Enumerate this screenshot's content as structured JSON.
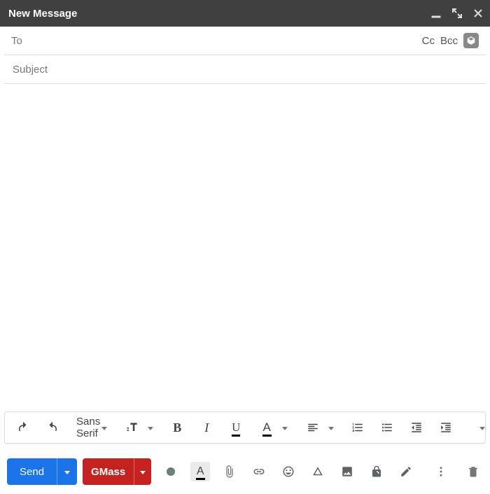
{
  "window": {
    "title": "New Message"
  },
  "to_field": {
    "label": "To",
    "value": "",
    "cc_label": "Cc",
    "bcc_label": "Bcc"
  },
  "subject_field": {
    "placeholder": "Subject",
    "value": ""
  },
  "body": {
    "value": ""
  },
  "format_toolbar": {
    "font_family": "Sans Serif",
    "text_color_glyph": "A"
  },
  "bottom": {
    "send_label": "Send",
    "gmass_label": "GMass",
    "highlight_glyph": "A"
  }
}
